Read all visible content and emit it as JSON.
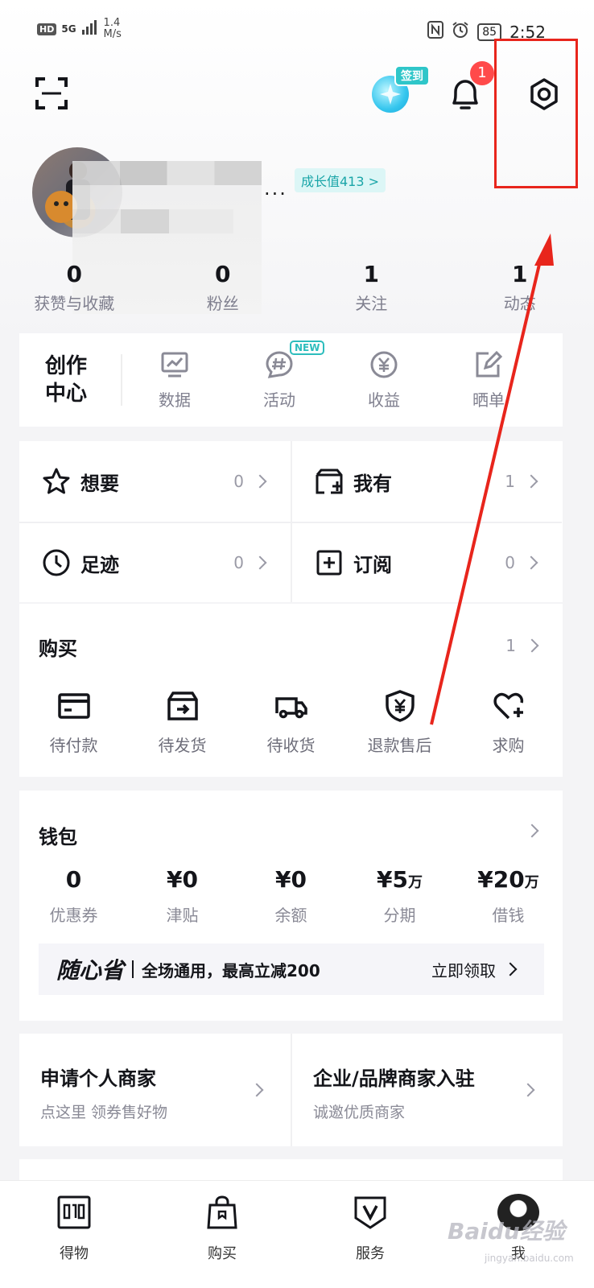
{
  "status_bar": {
    "hd": "HD",
    "network": "5G",
    "speed_value": "1.4",
    "speed_unit": "M/s",
    "battery": "85",
    "time": "2:52"
  },
  "header": {
    "sign_in_label": "签到",
    "notification_count": "1"
  },
  "profile": {
    "growth_value_label": "成长值413 >",
    "ellipsis": "...",
    "stats": [
      {
        "value": "0",
        "label": "获赞与收藏"
      },
      {
        "value": "0",
        "label": "粉丝"
      },
      {
        "value": "1",
        "label": "关注"
      },
      {
        "value": "1",
        "label": "动态"
      }
    ]
  },
  "creation_center": {
    "title_line1": "创作",
    "title_line2": "中心",
    "new_badge": "NEW",
    "items": [
      {
        "label": "数据",
        "icon": "chart-icon"
      },
      {
        "label": "活动",
        "icon": "hashtag-chat-icon"
      },
      {
        "label": "收益",
        "icon": "yen-circle-icon"
      },
      {
        "label": "晒单",
        "icon": "edit-icon"
      }
    ]
  },
  "shortcuts": [
    {
      "label": "想要",
      "count": "0",
      "icon": "star-icon"
    },
    {
      "label": "我有",
      "count": "1",
      "icon": "box-plus-icon"
    },
    {
      "label": "足迹",
      "count": "0",
      "icon": "clock-icon"
    },
    {
      "label": "订阅",
      "count": "0",
      "icon": "plus-square-icon"
    }
  ],
  "purchase": {
    "title": "购买",
    "count": "1",
    "items": [
      {
        "label": "待付款",
        "icon": "card-icon"
      },
      {
        "label": "待发货",
        "icon": "package-out-icon"
      },
      {
        "label": "待收货",
        "icon": "truck-icon"
      },
      {
        "label": "退款售后",
        "icon": "shield-yen-icon"
      },
      {
        "label": "求购",
        "icon": "heart-plus-icon"
      }
    ]
  },
  "wallet": {
    "title": "钱包",
    "items": [
      {
        "value": "0",
        "unit": "",
        "label": "优惠券"
      },
      {
        "value": "¥0",
        "unit": "",
        "label": "津贴"
      },
      {
        "value": "¥0",
        "unit": "",
        "label": "余额"
      },
      {
        "value": "¥5",
        "unit": "万",
        "label": "分期"
      },
      {
        "value": "¥20",
        "unit": "万",
        "label": "借钱"
      }
    ],
    "promo": {
      "brand": "随心省",
      "text": "全场通用，最高立减200",
      "cta": "立即领取"
    }
  },
  "merchant": [
    {
      "title": "申请个人商家",
      "subtitle": "点这里 领券售好物"
    },
    {
      "title": "企业/品牌商家入驻",
      "subtitle": "诚邀优质商家"
    }
  ],
  "tabbar": [
    {
      "label": "得物",
      "icon": "dewu-logo-icon"
    },
    {
      "label": "购买",
      "icon": "shopping-bag-icon"
    },
    {
      "label": "服务",
      "icon": "shield-v-icon"
    },
    {
      "label": "我",
      "icon": "me-avatar-icon"
    }
  ],
  "watermark": {
    "text": "Baidu经验",
    "sub": "jingyan.baidu.com"
  },
  "colors": {
    "accent_teal": "#2dbdbd",
    "badge_red": "#ff4a4a",
    "annotation_red": "#e8251c"
  }
}
